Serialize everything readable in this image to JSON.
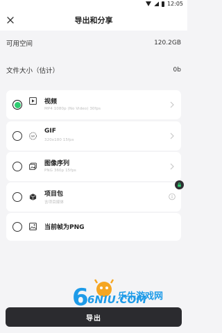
{
  "status_bar": {
    "time": "12:05"
  },
  "header": {
    "title": "导出和分享"
  },
  "storage": {
    "label": "可用空间",
    "value": "120.2GB"
  },
  "file_size": {
    "label": "文件大小（估计）",
    "value": "0b"
  },
  "formats": [
    {
      "name": "视频",
      "sub": "MP4 1080p (No Video) 30fps",
      "selected": true
    },
    {
      "name": "GIF",
      "sub": "320x180 15fps",
      "selected": false
    },
    {
      "name": "图像序列",
      "sub": "PNG 360p 15fps",
      "selected": false
    },
    {
      "name": "项目包",
      "sub": "含项目媒体",
      "selected": false
    },
    {
      "name": "当前帧为PNG",
      "sub": "",
      "selected": false
    }
  ],
  "export_button": {
    "label": "导出"
  },
  "watermark": {
    "text": "乐牛游戏网",
    "logo_text": "6NIU.COM"
  },
  "colors": {
    "accent": "#2ecc71",
    "button_bg": "#2b2b2f",
    "watermark_blue": "#1e9be8",
    "watermark_gold": "#f5a623"
  }
}
